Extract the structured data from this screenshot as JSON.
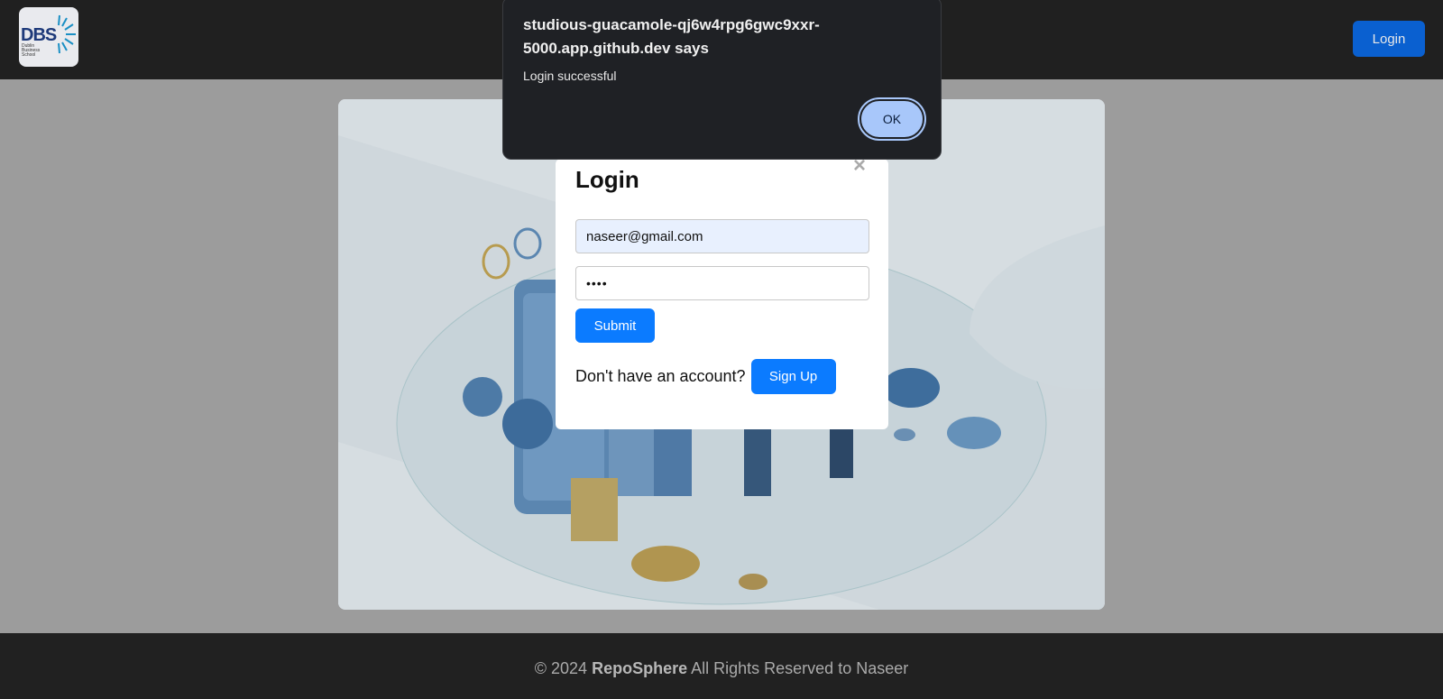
{
  "header": {
    "logo": {
      "text": "DBS",
      "subtext": "Dublin Business School"
    },
    "login_label": "Login"
  },
  "modal": {
    "title": "Login",
    "close_label": "×",
    "email_value": "naseer@gmail.com",
    "password_value": "••••",
    "submit_label": "Submit",
    "signup_prompt": "Don't have an account?",
    "signup_label": "Sign Up"
  },
  "alert": {
    "title": "studious-guacamole-qj6w4rpg6gwc9xxr-5000.app.github.dev says",
    "message": "Login successful",
    "ok_label": "OK"
  },
  "footer": {
    "copyright": "© 2024",
    "brand": "RepoSphere",
    "rights": "All Rights Reserved to Naseer"
  },
  "colors": {
    "primary_button": "#0b7bff",
    "header_button": "#0a60d0",
    "dialog_bg": "#1f2125",
    "ok_button": "#a8c7fa"
  }
}
